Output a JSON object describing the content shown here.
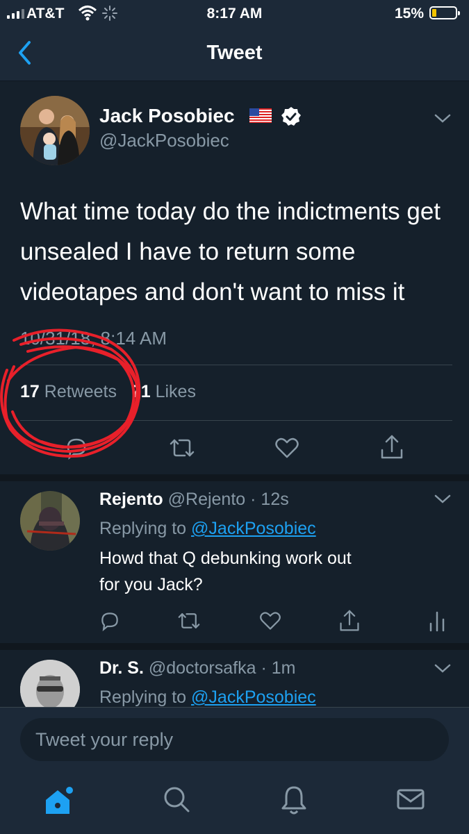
{
  "status_bar": {
    "carrier": "AT&T",
    "time": "8:17 AM",
    "battery": "15%"
  },
  "nav": {
    "title": "Tweet"
  },
  "tweet": {
    "author_name": "Jack Posobiec",
    "author_handle": "@JackPosobiec",
    "text": "What time today do the indictments get unsealed I have to return some videotapes and don't want to miss it",
    "timestamp": "10/31/18, 8:14 AM",
    "retweets_count": "17",
    "retweets_label": "Retweets",
    "likes_count": "71",
    "likes_label": "Likes"
  },
  "replies": [
    {
      "name": "Rejento",
      "handle": "@Rejento",
      "time": "12s",
      "replying_prefix": "Replying to",
      "replying_to": "@JackPosobiec",
      "text_line1": "Howd that Q debunking work out",
      "text_line2": "for you Jack?"
    },
    {
      "name": "Dr. S.",
      "handle": "@doctorsafka",
      "time": "1m",
      "replying_prefix": "Replying to",
      "replying_to": "@JackPosobiec"
    }
  ],
  "reply_box": {
    "placeholder": "Tweet your reply"
  },
  "icons": {
    "back": "chevron-left-icon",
    "more": "chevron-down-icon",
    "verified": "verified-badge-icon",
    "reply": "reply-icon",
    "retweet": "retweet-icon",
    "like": "heart-icon",
    "share": "share-icon",
    "analytics": "analytics-icon",
    "home": "home-icon",
    "search": "search-icon",
    "notifications": "bell-icon",
    "messages": "mail-icon"
  },
  "colors": {
    "background": "#15202b",
    "bar": "#1c2938",
    "accent": "#1da1f2",
    "muted": "#8899a6",
    "annotation": "#e8202a"
  }
}
